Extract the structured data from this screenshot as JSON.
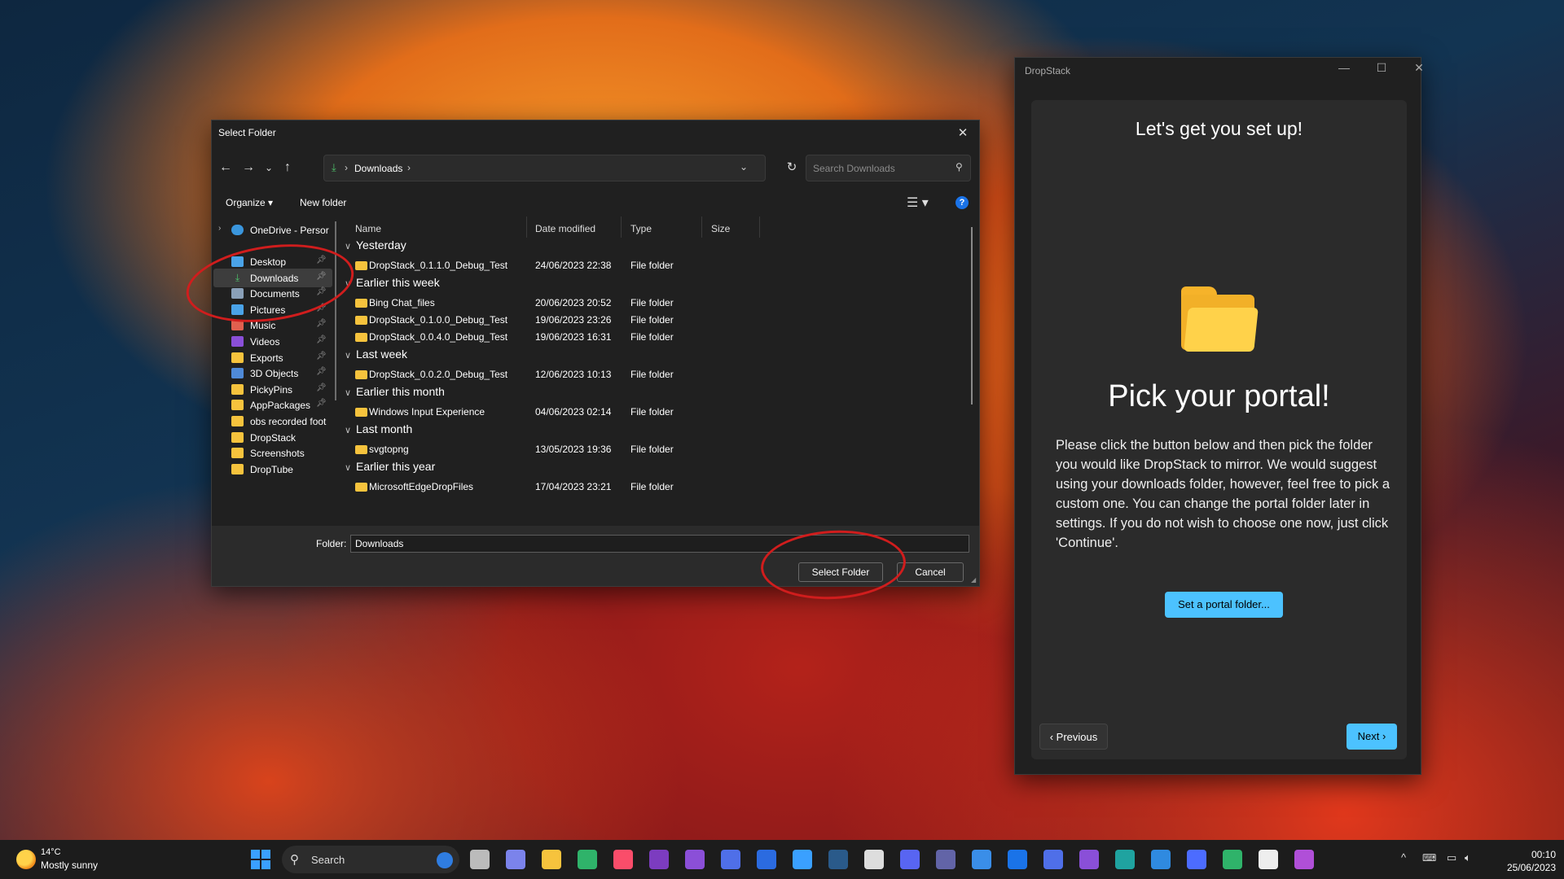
{
  "dialog": {
    "title": "Select Folder",
    "address_current": "Downloads",
    "address_sep": "›",
    "search_placeholder": "Search Downloads",
    "organize_label": "Organize ▾",
    "new_folder_label": "New folder",
    "help_label": "?",
    "sidebar": [
      {
        "label": "OneDrive - Persor",
        "kind": "cloud",
        "pinned": false,
        "selected": false
      },
      {
        "label": "Desktop",
        "kind": "desktop",
        "pinned": true,
        "selected": false
      },
      {
        "label": "Downloads",
        "kind": "downloads",
        "pinned": true,
        "selected": true
      },
      {
        "label": "Documents",
        "kind": "documents",
        "pinned": true,
        "selected": false
      },
      {
        "label": "Pictures",
        "kind": "pictures",
        "pinned": true,
        "selected": false
      },
      {
        "label": "Music",
        "kind": "music",
        "pinned": true,
        "selected": false
      },
      {
        "label": "Videos",
        "kind": "videos",
        "pinned": true,
        "selected": false
      },
      {
        "label": "Exports",
        "kind": "folder",
        "pinned": true,
        "selected": false
      },
      {
        "label": "3D Objects",
        "kind": "3d",
        "pinned": true,
        "selected": false
      },
      {
        "label": "PickyPins",
        "kind": "folder",
        "pinned": true,
        "selected": false
      },
      {
        "label": "AppPackages",
        "kind": "folder",
        "pinned": true,
        "selected": false
      },
      {
        "label": "obs recorded foot",
        "kind": "folder",
        "pinned": false,
        "selected": false
      },
      {
        "label": "DropStack",
        "kind": "folder",
        "pinned": false,
        "selected": false
      },
      {
        "label": "Screenshots",
        "kind": "folder",
        "pinned": false,
        "selected": false
      },
      {
        "label": "DropTube",
        "kind": "folder",
        "pinned": false,
        "selected": false
      }
    ],
    "columns": {
      "name": "Name",
      "date": "Date modified",
      "type": "Type",
      "size": "Size"
    },
    "groups": [
      {
        "label": "Yesterday",
        "rows": [
          {
            "name": "DropStack_0.1.1.0_Debug_Test",
            "date": "24/06/2023 22:38",
            "type": "File folder"
          }
        ]
      },
      {
        "label": "Earlier this week",
        "rows": [
          {
            "name": "Bing Chat_files",
            "date": "20/06/2023 20:52",
            "type": "File folder"
          },
          {
            "name": "DropStack_0.1.0.0_Debug_Test",
            "date": "19/06/2023 23:26",
            "type": "File folder"
          },
          {
            "name": "DropStack_0.0.4.0_Debug_Test",
            "date": "19/06/2023 16:31",
            "type": "File folder"
          }
        ]
      },
      {
        "label": "Last week",
        "rows": [
          {
            "name": "DropStack_0.0.2.0_Debug_Test",
            "date": "12/06/2023 10:13",
            "type": "File folder"
          }
        ]
      },
      {
        "label": "Earlier this month",
        "rows": [
          {
            "name": "Windows Input Experience",
            "date": "04/06/2023 02:14",
            "type": "File folder"
          }
        ]
      },
      {
        "label": "Last month",
        "rows": [
          {
            "name": "svgtopng",
            "date": "13/05/2023 19:36",
            "type": "File folder"
          }
        ]
      },
      {
        "label": "Earlier this year",
        "rows": [
          {
            "name": "MicrosoftEdgeDropFiles",
            "date": "17/04/2023 23:21",
            "type": "File folder"
          }
        ]
      }
    ],
    "folder_label": "Folder:",
    "folder_value": "Downloads",
    "select_label": "Select Folder",
    "cancel_label": "Cancel"
  },
  "dropstack": {
    "title": "DropStack",
    "heading": "Let's get you set up!",
    "subheading": "Pick your portal!",
    "body": "Please click the button below and then pick the folder you would like DropStack to mirror. We would suggest using your downloads folder, however, feel free to pick a custom one. You can change the portal folder later in settings. If you do not wish to choose one now, just click 'Continue'.",
    "set_folder_label": "Set a portal folder...",
    "prev_label": "‹ Previous",
    "next_label": "Next ›"
  },
  "taskbar": {
    "weather_temp": "14°C",
    "weather_desc": "Mostly sunny",
    "search_label": "Search",
    "time": "00:10",
    "date": "25/06/2023"
  },
  "colors": {
    "accent": "#4cc2ff",
    "folder": "#f6c33d",
    "annotation": "#d01d1d"
  }
}
